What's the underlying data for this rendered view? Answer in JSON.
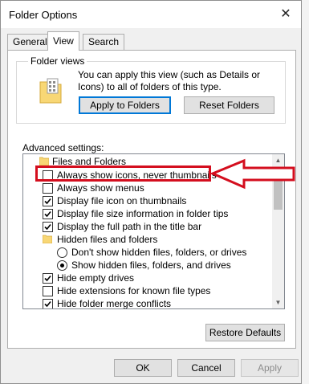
{
  "window": {
    "title": "Folder Options",
    "close_glyph": "✕"
  },
  "tabs": [
    {
      "label": "General",
      "active": false
    },
    {
      "label": "View",
      "active": true
    },
    {
      "label": "Search",
      "active": false
    }
  ],
  "folder_views": {
    "legend": "Folder views",
    "description": "You can apply this view (such as Details or Icons) to all of folders of this type.",
    "apply_button": "Apply to Folders",
    "reset_button": "Reset Folders"
  },
  "advanced": {
    "label": "Advanced settings:",
    "items": [
      {
        "type": "folder",
        "label": "Files and Folders"
      },
      {
        "type": "checkbox",
        "label": "Always show icons, never thumbnails",
        "checked": false
      },
      {
        "type": "checkbox",
        "label": "Always show menus",
        "checked": false
      },
      {
        "type": "checkbox",
        "label": "Display file icon on thumbnails",
        "checked": true
      },
      {
        "type": "checkbox",
        "label": "Display file size information in folder tips",
        "checked": true
      },
      {
        "type": "checkbox",
        "label": "Display the full path in the title bar",
        "checked": true
      },
      {
        "type": "folder",
        "label": "Hidden files and folders"
      },
      {
        "type": "radio",
        "label": "Don't show hidden files, folders, or drives",
        "checked": false
      },
      {
        "type": "radio",
        "label": "Show hidden files, folders, and drives",
        "checked": true
      },
      {
        "type": "checkbox",
        "label": "Hide empty drives",
        "checked": true
      },
      {
        "type": "checkbox",
        "label": "Hide extensions for known file types",
        "checked": false
      },
      {
        "type": "checkbox",
        "label": "Hide folder merge conflicts",
        "checked": true
      }
    ],
    "restore_button": "Restore Defaults"
  },
  "footer": {
    "ok": "OK",
    "cancel": "Cancel",
    "apply": "Apply"
  },
  "colors": {
    "annotation_red": "#d40e1e",
    "accent_blue": "#0078d7",
    "folder_yellow": "#f8d775"
  }
}
